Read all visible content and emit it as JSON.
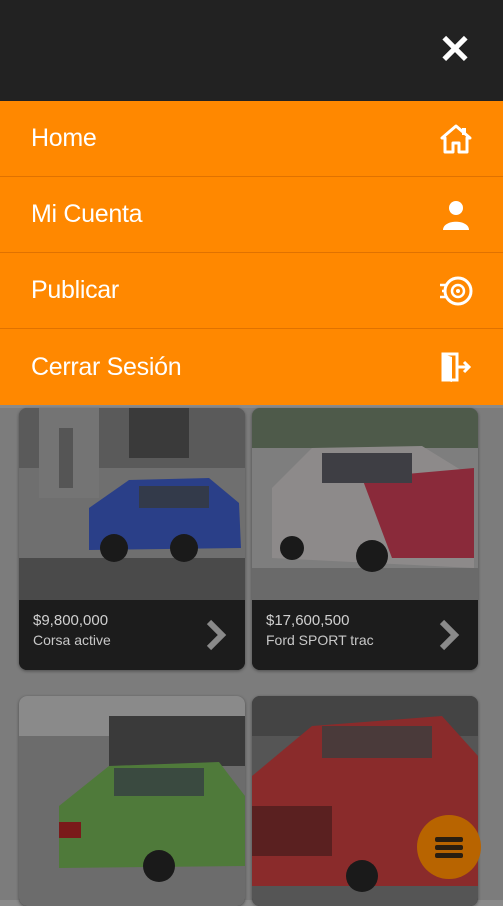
{
  "menu": {
    "items": [
      {
        "label": "Home",
        "icon": "home-icon"
      },
      {
        "label": "Mi Cuenta",
        "icon": "user-icon"
      },
      {
        "label": "Publicar",
        "icon": "tire-icon"
      },
      {
        "label": "Cerrar Sesión",
        "icon": "logout-icon"
      }
    ]
  },
  "header": {
    "close_icon": "close-icon"
  },
  "listings": [
    {
      "price": "$9,800,000",
      "title": "Corsa active",
      "color": "#2a3f88"
    },
    {
      "price": "$17,600,500",
      "title": "Ford SPORT trac",
      "color": "#8a2a3a"
    },
    {
      "price": "",
      "title": "",
      "color": "#4f7a3a"
    },
    {
      "price": "",
      "title": "",
      "color": "#8a2b2b"
    }
  ],
  "colors": {
    "accent": "#ff8800",
    "topbar": "#222222"
  },
  "fab": {
    "icon": "hamburger-menu-icon"
  }
}
